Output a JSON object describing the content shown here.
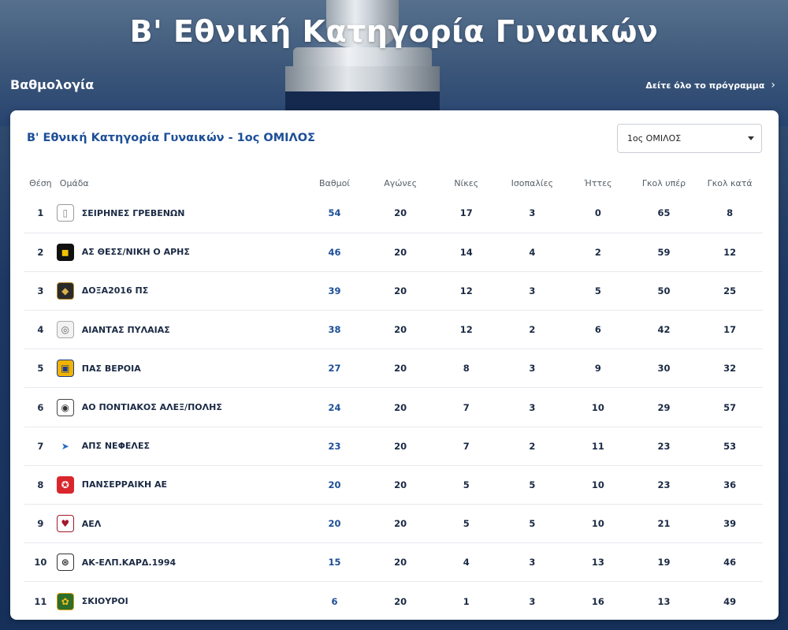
{
  "header": {
    "title": "Β' Εθνική Κατηγορία Γυναικών",
    "section_title": "Βαθμολογία",
    "schedule_link": "Δείτε όλο το πρόγραμμα"
  },
  "card": {
    "title": "Β' Εθνική Κατηγορία Γυναικών - 1ος ΟΜΙΛΟΣ",
    "group_select": {
      "selected": "1ος ΟΜΙΛΟΣ"
    }
  },
  "table": {
    "columns": {
      "position": "Θέση",
      "team": "Ομάδα",
      "points": "Βαθμοί",
      "played": "Αγώνες",
      "wins": "Νίκες",
      "draws": "Ισοπαλίες",
      "losses": "Ήττες",
      "goals_for": "Γκολ υπέρ",
      "goals_against": "Γκολ κατά"
    },
    "rows": [
      {
        "pos": "1",
        "team": "ΣΕΙΡΗΝΕΣ ΓΡΕΒΕΝΩΝ",
        "logo": "shirt-outline-icon",
        "pts": "54",
        "played": "20",
        "wins": "17",
        "draws": "3",
        "losses": "0",
        "gf": "65",
        "ga": "8"
      },
      {
        "pos": "2",
        "team": "ΑΣ ΘΕΣΣ/ΝΙΚΗ Ο ΑΡΗΣ",
        "logo": "aris-crest-icon",
        "pts": "46",
        "played": "20",
        "wins": "14",
        "draws": "4",
        "losses": "2",
        "gf": "59",
        "ga": "12"
      },
      {
        "pos": "3",
        "team": "ΔΟΞΑ2016 ΠΣ",
        "logo": "doxa-crest-icon",
        "pts": "39",
        "played": "20",
        "wins": "12",
        "draws": "3",
        "losses": "5",
        "gf": "50",
        "ga": "25"
      },
      {
        "pos": "4",
        "team": "ΑΙΑΝΤΑΣ ΠΥΛΑΙΑΣ",
        "logo": "aiantas-crest-icon",
        "pts": "38",
        "played": "20",
        "wins": "12",
        "draws": "2",
        "losses": "6",
        "gf": "42",
        "ga": "17"
      },
      {
        "pos": "5",
        "team": "ΠΑΣ ΒΕΡΟΙΑ",
        "logo": "veroia-crest-icon",
        "pts": "27",
        "played": "20",
        "wins": "8",
        "draws": "3",
        "losses": "9",
        "gf": "30",
        "ga": "32"
      },
      {
        "pos": "6",
        "team": "ΑΟ ΠΟΝΤΙΑΚΟΣ ΑΛΕΞ/ΠΟΛΗΣ",
        "logo": "pontiakos-crest-icon",
        "pts": "24",
        "played": "20",
        "wins": "7",
        "draws": "3",
        "losses": "10",
        "gf": "29",
        "ga": "57"
      },
      {
        "pos": "7",
        "team": "ΑΠΣ ΝΕΦΕΛΕΣ",
        "logo": "nefeles-crest-icon",
        "pts": "23",
        "played": "20",
        "wins": "7",
        "draws": "2",
        "losses": "11",
        "gf": "23",
        "ga": "53"
      },
      {
        "pos": "8",
        "team": "ΠΑΝΣΕΡΡΑΙΚΗ ΑΕ",
        "logo": "panserraikos-crest-icon",
        "pts": "20",
        "played": "20",
        "wins": "5",
        "draws": "5",
        "losses": "10",
        "gf": "23",
        "ga": "36"
      },
      {
        "pos": "9",
        "team": "ΑΕΛ",
        "logo": "ael-crest-icon",
        "pts": "20",
        "played": "20",
        "wins": "5",
        "draws": "5",
        "losses": "10",
        "gf": "21",
        "ga": "39"
      },
      {
        "pos": "10",
        "team": "ΑΚ-ΕΛΠ.ΚΑΡΔ.1994",
        "logo": "ak-elp-crest-icon",
        "pts": "15",
        "played": "20",
        "wins": "4",
        "draws": "3",
        "losses": "13",
        "gf": "19",
        "ga": "46"
      },
      {
        "pos": "11",
        "team": "ΣΚΙΟΥΡΟΙ",
        "logo": "skiouroi-crest-icon",
        "pts": "6",
        "played": "20",
        "wins": "1",
        "draws": "3",
        "losses": "16",
        "gf": "13",
        "ga": "49"
      }
    ]
  },
  "colors": {
    "accent": "#1d4f97",
    "text": "#1b2a44",
    "background": "#1d3863"
  }
}
